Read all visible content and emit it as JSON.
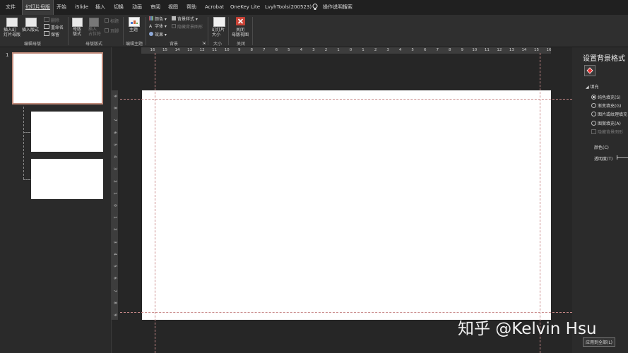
{
  "tabs": [
    "文件",
    "幻灯片母版",
    "开始",
    "iSlide",
    "插入",
    "切换",
    "动画",
    "审阅",
    "视图",
    "帮助",
    "Acrobat",
    "OneKey Lite",
    "LvyhTools(200523)",
    "操作说明搜索"
  ],
  "ribbon": {
    "insert_master": "插入幻\n灯片母版",
    "insert_layout": "插入版式",
    "delete": "删除",
    "rename": "重命名",
    "preserve": "保留",
    "group_edit_master": "编辑母版",
    "master_layout": "母版\n版式",
    "insert_placeholder": "插入\n占位符",
    "title": "标题",
    "footer": "页脚",
    "group_master_layout": "母版版式",
    "theme": "主题",
    "group_edit_theme": "编辑主题",
    "colors": "颜色",
    "fonts": "字体",
    "effects": "效果",
    "background_styles": "背景样式",
    "hide_bg_graphics": "隐藏背景图形",
    "group_background": "背景",
    "slide_size": "幻灯片\n大小",
    "group_size": "大小",
    "close_master_view": "关闭\n母版视图",
    "group_close": "关闭"
  },
  "thumbnails": {
    "first_number": "1"
  },
  "ruler": {
    "h_ticks": [
      "16",
      "15",
      "14",
      "13",
      "12",
      "11",
      "10",
      "9",
      "8",
      "7",
      "6",
      "5",
      "4",
      "3",
      "2",
      "1",
      "0",
      "1",
      "2",
      "3",
      "4",
      "5",
      "6",
      "7",
      "8",
      "9",
      "10",
      "11",
      "12",
      "13",
      "14",
      "15",
      "16"
    ],
    "v_ticks": [
      "9",
      "8",
      "7",
      "6",
      "5",
      "4",
      "3",
      "2",
      "1",
      "0",
      "1",
      "2",
      "3",
      "4",
      "5",
      "6",
      "7",
      "8",
      "9"
    ]
  },
  "format_pane": {
    "title": "设置背景格式",
    "section_fill": "填充",
    "solid_fill": "纯色填充(S)",
    "gradient_fill": "渐变填充(G)",
    "picture_fill": "图片或纹理填充",
    "pattern_fill": "图案填充(A)",
    "hide_bg": "隐藏背景图形",
    "color": "颜色(C)",
    "transparency": "透明度(T)",
    "apply_all": "应用到全部(L)"
  },
  "watermark": "知乎 @Kelvin Hsu"
}
